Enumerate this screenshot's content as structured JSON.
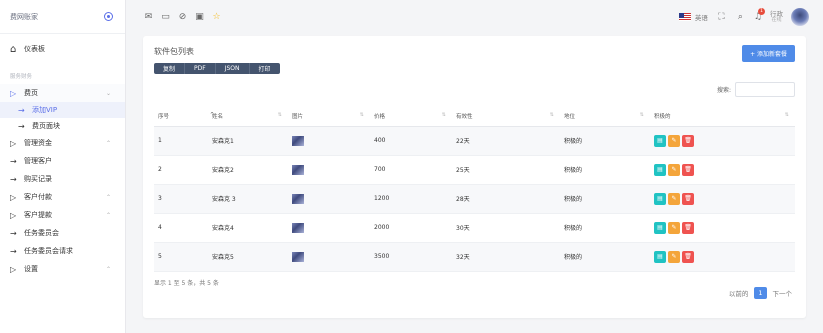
{
  "sidebar": {
    "brand": "费网账家",
    "dashboard": "仪表板",
    "section_title": "服务财务",
    "fees": {
      "label": "费页",
      "children": [
        "添加VIP",
        "费页面块"
      ]
    },
    "items": [
      {
        "label": "管理资金"
      },
      {
        "label": "管理客户"
      },
      {
        "label": "购买记录"
      },
      {
        "label": "客户付款"
      },
      {
        "label": "客户提款"
      },
      {
        "label": "任务委员会"
      },
      {
        "label": "任务委员会请求"
      },
      {
        "label": "设置"
      }
    ]
  },
  "topbar": {
    "language": "英语",
    "notification_count": "1",
    "user_name": "行政",
    "user_status": "在线"
  },
  "card": {
    "title": "软件包列表",
    "add_button": "+ 添加新套餐",
    "export_buttons": [
      "复制",
      "PDF",
      "JSON",
      "打印"
    ],
    "search_label": "搜索:",
    "search_value": ""
  },
  "table": {
    "headers": [
      "序号",
      "姓名",
      "图片",
      "价格",
      "有效性",
      "地位",
      "积极的"
    ],
    "rows": [
      {
        "no": "1",
        "name": "安森克1",
        "price": "400",
        "validity": "22天",
        "status": "积极的"
      },
      {
        "no": "2",
        "name": "安森克2",
        "price": "700",
        "validity": "25天",
        "status": "积极的"
      },
      {
        "no": "3",
        "name": "安森克 3",
        "price": "1200",
        "validity": "28天",
        "status": "积极的"
      },
      {
        "no": "4",
        "name": "安森克4",
        "price": "2000",
        "validity": "30天",
        "status": "积极的"
      },
      {
        "no": "5",
        "name": "安森克5",
        "price": "3500",
        "validity": "32天",
        "status": "积极的"
      }
    ]
  },
  "footer": {
    "info": "显示 1 至 5 条，共 5 条",
    "prev": "以前的",
    "page": "1",
    "next": "下一个"
  },
  "colors": {
    "accent": "#4f8be8",
    "sidebar_active": "#5a6ee8",
    "view": "#20c3c3",
    "edit": "#f4a53b",
    "delete": "#ef5350"
  }
}
